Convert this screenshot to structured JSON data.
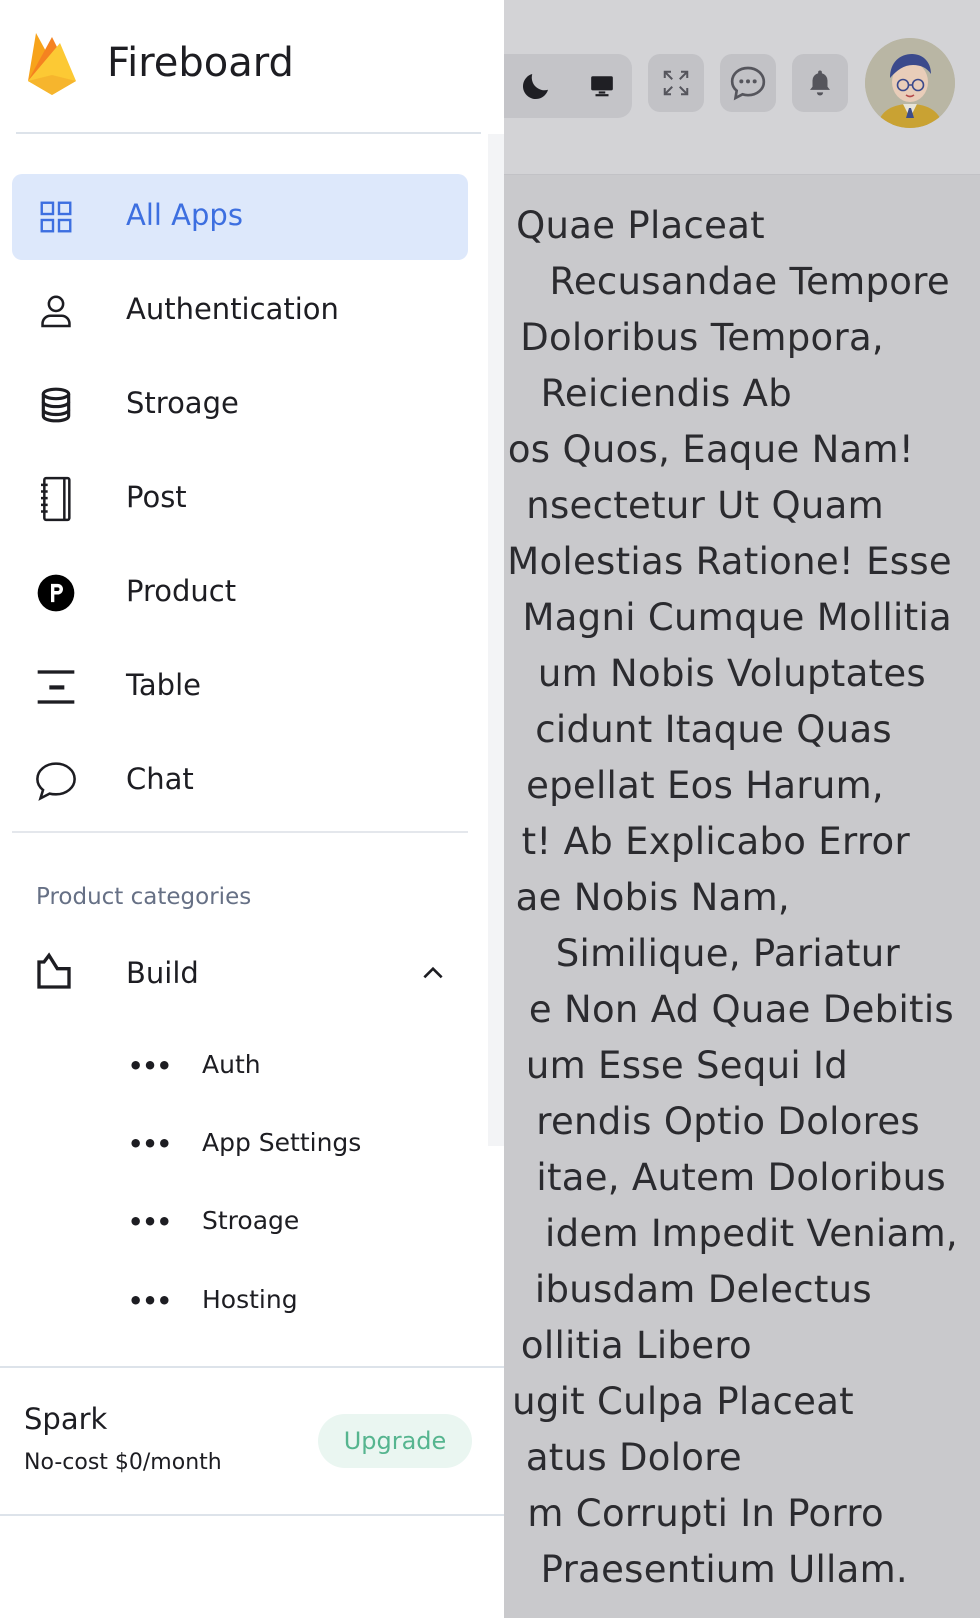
{
  "app": {
    "title": "Fireboard"
  },
  "nav": {
    "items": [
      {
        "label": "All Apps",
        "icon": "grid-icon",
        "active": true
      },
      {
        "label": "Authentication",
        "icon": "user-icon"
      },
      {
        "label": "Stroage",
        "icon": "database-icon"
      },
      {
        "label": "Post",
        "icon": "notebook-icon"
      },
      {
        "label": "Product",
        "icon": "product-p-icon"
      },
      {
        "label": "Table",
        "icon": "table-icon"
      },
      {
        "label": "Chat",
        "icon": "chat-bubble-icon"
      }
    ]
  },
  "categories": {
    "title": "Product categories",
    "group": {
      "label": "Build",
      "icon": "build-icon",
      "expanded": true,
      "items": [
        {
          "label": "Auth"
        },
        {
          "label": "App Settings"
        },
        {
          "label": "Stroage"
        },
        {
          "label": "Hosting"
        }
      ]
    }
  },
  "plan": {
    "name": "Spark",
    "price": "No-cost $0/month",
    "upgrade_label": "Upgrade"
  },
  "background": {
    "text_lines": [
      "Quae Placeat",
      "Recusandae Tempore",
      "Doloribus Tempora,",
      "Reiciendis Ab",
      "os Quos, Eaque Nam!",
      "nsectetur Ut Quam",
      "Molestias Ratione! Esse",
      "Magni Cumque Mollitia",
      "um Nobis Voluptates",
      "cidunt Itaque Quas",
      "epellat Eos Harum,",
      "t! Ab Explicabo Error",
      "ae Nobis Nam,",
      "Similique, Pariatur",
      "e Non Ad Quae Debitis",
      "um Esse Sequi Id",
      "rendis Optio Dolores",
      "itae, Autem Doloribus",
      "idem Impedit Veniam,",
      "ibusdam Delectus",
      "ollitia Libero",
      "ugit Culpa Placeat",
      "atus Dolore",
      "m Corrupti In Porro",
      "Praesentium Ullam."
    ]
  },
  "colors": {
    "accent": "#3d6fe0",
    "active_bg": "#dde8fb",
    "upgrade_text": "#56b58f",
    "upgrade_bg": "#eaf6f1",
    "overlay": "#c9c9cc"
  }
}
